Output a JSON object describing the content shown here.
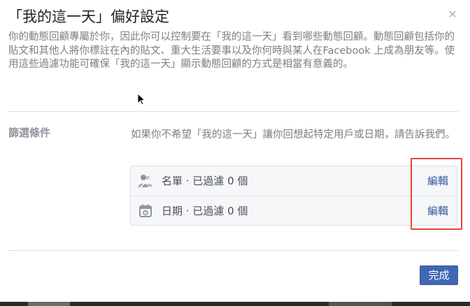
{
  "dialog": {
    "title": "「我的這一天」偏好設定",
    "description": "你的動態回顧專屬於你，因此你可以控制要在「我的這一天」看到哪些動態回顧。動態回顧包括你的貼文和其他人將你標註在內的貼文、重大生活要事以及你何時與某人在Facebook 上成為朋友等。使用這些過濾功能可確保「我的這一天」顯示動態回顧的方式是相當有意義的。",
    "close_icon": "close-icon"
  },
  "filters": {
    "label": "篩選條件",
    "description": "如果你不希望「我的這一天」讓你回想起特定用戶或日期，請告訴我們。",
    "rows": [
      {
        "icon": "people-icon",
        "label": "名單 · 已過濾 0 個",
        "edit_label": "編輯"
      },
      {
        "icon": "calendar-icon",
        "label": "日期 · 已過濾 0 個",
        "edit_label": "編輯"
      }
    ]
  },
  "footer": {
    "done_label": "完成"
  },
  "colors": {
    "primary_button": "#4267b2",
    "link": "#365899",
    "highlight_box": "#e8453c"
  }
}
